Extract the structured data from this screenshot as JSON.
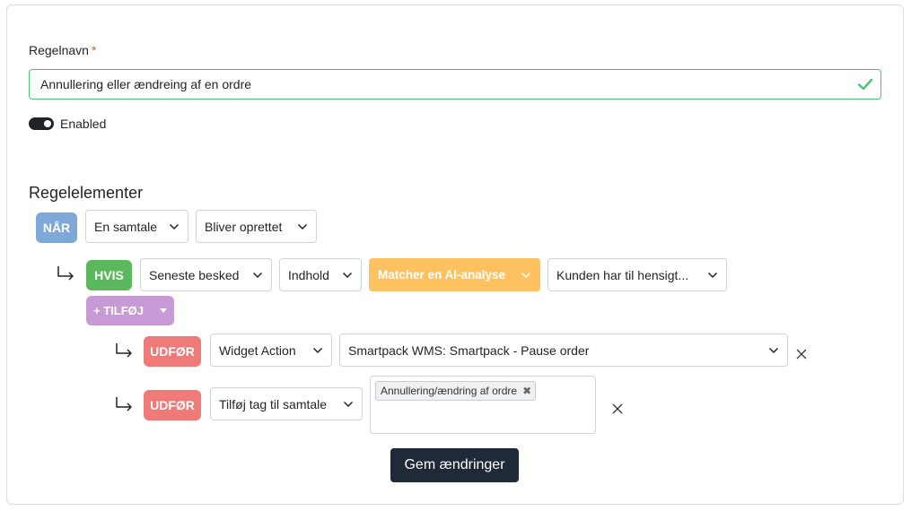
{
  "form": {
    "name_label": "Regelnavn",
    "required_marker": "*",
    "name_value": "Annullering eller ændreing af en ordre",
    "enabled_label": "Enabled",
    "enabled": true,
    "section_title": "Regelelementer"
  },
  "when": {
    "badge": "NÅR",
    "subject": "En samtale",
    "event": "Bliver oprettet"
  },
  "condition": {
    "badge": "HVIS",
    "field": "Seneste besked",
    "property": "Indhold",
    "operator": "Matcher en AI-analyse",
    "value": "Kunden har til hensigt..."
  },
  "add_button": "+ TILFØJ",
  "actions": [
    {
      "badge": "UDFØR",
      "type": "Widget Action",
      "value": "Smartpack WMS: Smartpack - Pause order"
    },
    {
      "badge": "UDFØR",
      "type": "Tilføj tag til samtale",
      "tag": "Annullering/ændring af ordre"
    }
  ],
  "save_label": "Gem ændringer",
  "colors": {
    "when": "#7ea8d8",
    "condition": "#5cb85c",
    "action": "#f07a78",
    "operator": "#fdc25f",
    "add": "#c79ad6",
    "valid": "#4fc27a",
    "save": "#1f2937"
  }
}
